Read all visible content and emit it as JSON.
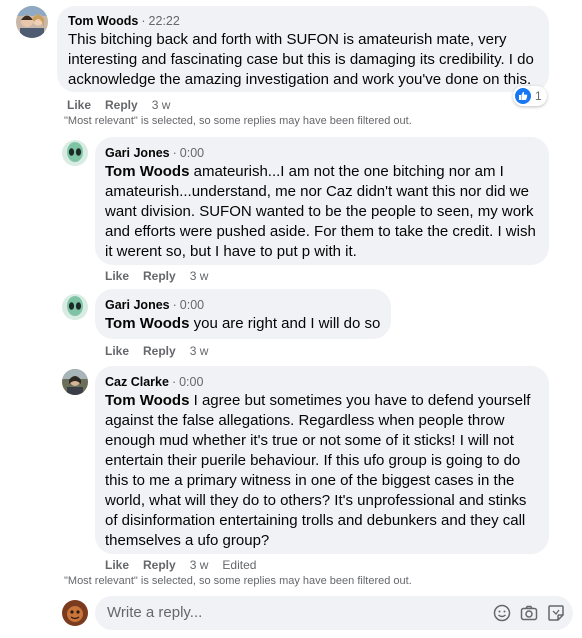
{
  "comments": [
    {
      "author": "Tom Woods",
      "time": "22:22",
      "mention": "",
      "text": "This bitching back and forth with SUFON is amateurish mate, very interesting and fascinating case but this is damaging its credibility. I do acknowledge the amazing investigation and work you've done on this.",
      "like_label": "Like",
      "reply_label": "Reply",
      "age": "3 w",
      "reaction_count": "1"
    },
    {
      "author": "Gari Jones",
      "time": "0:00",
      "mention": "Tom Woods",
      "text": " amateurish...I am not the one bitching nor am I amateurish...understand, me nor Caz didn't want this nor did we want division. SUFON wanted to be the people to seen, my work and efforts were pushed aside. For them to take the credit. I wish it werent so, but I have to put p with it.",
      "like_label": "Like",
      "reply_label": "Reply",
      "age": "3 w"
    },
    {
      "author": "Gari Jones",
      "time": "0:00",
      "mention": "Tom Woods",
      "text": " you are right and I will do so",
      "like_label": "Like",
      "reply_label": "Reply",
      "age": "3 w"
    },
    {
      "author": "Caz Clarke",
      "time": "0:00",
      "mention": "Tom Woods",
      "text": " I agree but sometimes you have to defend yourself against the false allegations. Regardless when people throw enough mud whether it's true or not some of it sticks! I will not entertain their puerile behaviour. If this ufo group is going to do this to me a primary witness in one of the biggest cases in the world, what will they do to others? It's unprofessional and stinks of disinformation entertaining trolls and debunkers and they call themselves a ufo group?",
      "like_label": "Like",
      "reply_label": "Reply",
      "age": "3 w",
      "edited": "Edited"
    }
  ],
  "filter_note": "\"Most relevant\" is selected, so some replies may have been filtered out.",
  "reply_box": {
    "placeholder": "Write a reply..."
  },
  "icons": {
    "emoji": "emoji-icon",
    "camera": "camera-icon",
    "gif": "gif-sticker-icon"
  },
  "colors": {
    "bubble": "#f0f2f5",
    "like_blue": "#1877f2",
    "meta_gray": "#65676b"
  }
}
